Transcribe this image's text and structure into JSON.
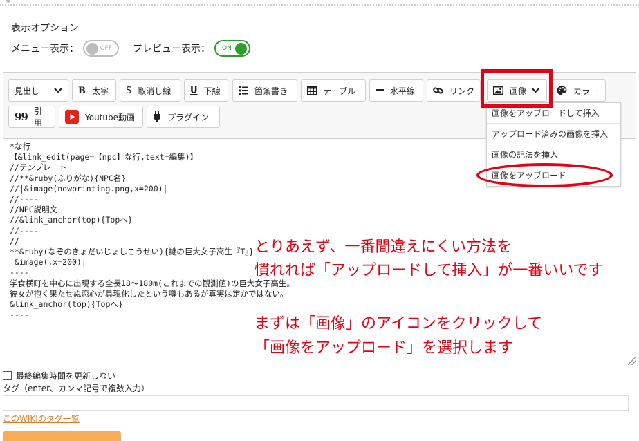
{
  "options": {
    "title": "表示オプション",
    "menu_label": "メニュー表示：",
    "menu_toggle": "OFF",
    "preview_label": "プレビュー表示：",
    "preview_toggle": "ON"
  },
  "toolbar": {
    "heading": "見出し",
    "bold": "太字",
    "strike": "取消し線",
    "underline": "下線",
    "bullets": "箇条書き",
    "table": "テーブル",
    "hr": "水平線",
    "link": "リンク",
    "image": "画像",
    "color": "カラー",
    "quote": "引用",
    "youtube": "Youtube動画",
    "plugin": "プラグイン"
  },
  "icons": {
    "bold": "B",
    "strike": "S",
    "underline": "U",
    "quote": "99"
  },
  "image_menu": [
    "画像をアップロードして挿入",
    "アップロード済みの画像を挿入",
    "画像の記法を挿入",
    "画像をアップロード"
  ],
  "editor_text": "*な行\n【&link_edit(page=【npc】な行,text=編集)】\n//テンプレート\n//**&ruby(ふりがな){NPC名}\n//|&image(nowprinting.png,x=200)|\n//----\n//NPC説明文\n//&link_anchor(top){Topへ}\n//----\n//\n**&ruby(なぞのきょだいじょしこうせい){謎の巨大女子高生『T』}\n|&image(,x=200)|\n----\n学食横町を中心に出現する全長18～180m(これまでの観測値)の巨大女子高生。\n彼女が抱く果たせぬ恋心が具現化したという噂もあるが真実は定かではない。\n&link_anchor(top){Topへ}\n----",
  "annotations": {
    "line1": "とりあえず、一番間違えにくい方法を",
    "line2": "慣れれば「アップロードして挿入」が一番いいです",
    "line3": "まずは「画像」のアイコンをクリックして",
    "line4": "「画像をアップロード」を選択します"
  },
  "bottom": {
    "no_update_label": "最終編集時間を更新しない",
    "tag_label": "タグ（enter、カンマ記号で複数入力）",
    "tag_list_link": "このWIKIのタグ一覧"
  },
  "colors": {
    "annotation_red": "#e60012",
    "toggle_on_green": "#2aa02a",
    "link_orange": "#e07b2a",
    "submit_orange": "#f6ad55"
  }
}
